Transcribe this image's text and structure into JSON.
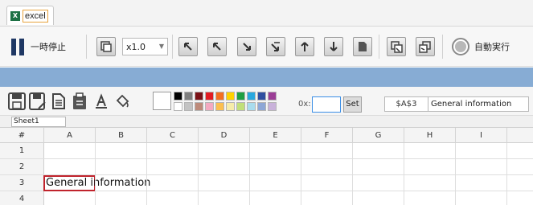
{
  "tab": {
    "label": "excel",
    "icon": "excel-icon"
  },
  "toolbar": {
    "pause_label": "一時停止",
    "speed_value": "x1.0",
    "auto_label": "自動実行"
  },
  "format_bar": {
    "x_label": "0x:",
    "x_value": "",
    "set_label": "Set",
    "palette_row1": [
      "#000000",
      "#7f7f7f",
      "#7b1116",
      "#e21b23",
      "#f36f21",
      "#ffd200",
      "#1e9f43",
      "#29a8df",
      "#2f4fa0",
      "#9b3e96"
    ],
    "palette_row2": [
      "#ffffff",
      "#c3c3c3",
      "#bd8a7a",
      "#f4a9c0",
      "#fcbf4f",
      "#f6ecaa",
      "#c1df7a",
      "#a9dcee",
      "#8ea7d6",
      "#c9b2da"
    ]
  },
  "name_box": "$A$3",
  "formula_value": "General information",
  "sheet_tab": "Sheet1",
  "grid": {
    "corner": "#",
    "columns": [
      "A",
      "B",
      "C",
      "D",
      "E",
      "F",
      "G",
      "H",
      "I"
    ],
    "rows": [
      "1",
      "2",
      "3",
      "4"
    ],
    "cell_A3": "General information"
  }
}
